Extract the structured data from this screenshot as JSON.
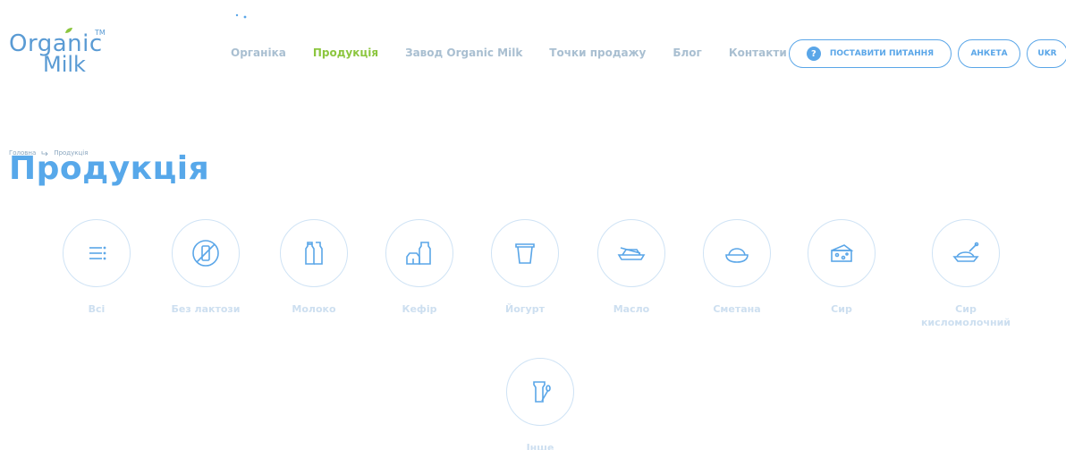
{
  "logo": {
    "line1": "Organic",
    "line2": "Milk",
    "tm": "TM"
  },
  "nav": [
    {
      "label": "Органіка",
      "active": false
    },
    {
      "label": "Продукція",
      "active": true
    },
    {
      "label": "Завод Organic Milk",
      "active": false
    },
    {
      "label": "Точки продажу",
      "active": false
    },
    {
      "label": "Блог",
      "active": false
    },
    {
      "label": "Контакти",
      "active": false
    }
  ],
  "buttons": {
    "ask_icon": "?",
    "ask_label": "Поставити питання",
    "anketa_label": "Анкета",
    "lang_label": "UKR"
  },
  "breadcrumb": {
    "home": "Головна",
    "current": "Продукція"
  },
  "page_title": "Продукція",
  "categories": [
    {
      "label": "Всі",
      "icon": "list-icon"
    },
    {
      "label": "Без лактози",
      "icon": "no-lactose-icon"
    },
    {
      "label": "Молоко",
      "icon": "milk-bottles-icon"
    },
    {
      "label": "Кефір",
      "icon": "kefir-cartons-icon"
    },
    {
      "label": "Йогурт",
      "icon": "yogurt-cup-icon"
    },
    {
      "label": "Масло",
      "icon": "butter-dish-icon"
    },
    {
      "label": "Сметана",
      "icon": "sour-cream-bowl-icon"
    },
    {
      "label": "Сир",
      "icon": "cheese-icon"
    },
    {
      "label": "Сир кисломолочний",
      "icon": "cottage-cheese-icon"
    },
    {
      "label": "Інше",
      "icon": "other-products-icon"
    }
  ],
  "colors": {
    "accent": "#57a8ea",
    "active_nav": "#8cc63f",
    "icon_stroke": "#5aa6e8",
    "circle_border": "#cfe3f5"
  }
}
